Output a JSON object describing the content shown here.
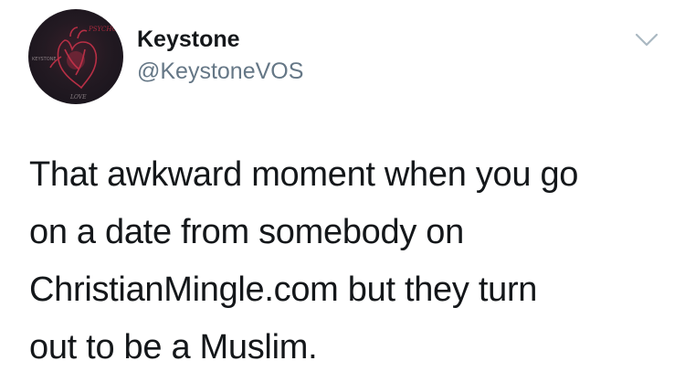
{
  "tweet": {
    "author": {
      "display_name": "Keystone",
      "handle": "@KeystoneVOS",
      "avatar": {
        "icon": "heart-artwork-avatar",
        "text_top": "PSYCHO",
        "text_side": "KEYSTONE",
        "text_bottom": "LOVE"
      }
    },
    "menu_icon": "chevron-down-icon",
    "text_lines": [
      "That awkward moment when you go",
      "on a date from somebody on",
      "ChristianMingle.com but they turn",
      "out to be a Muslim."
    ]
  },
  "colors": {
    "text": "#14171a",
    "secondary_text": "#657786",
    "chevron": "#aab8c2",
    "background": "#ffffff",
    "avatar_accent": "#c8324a"
  }
}
